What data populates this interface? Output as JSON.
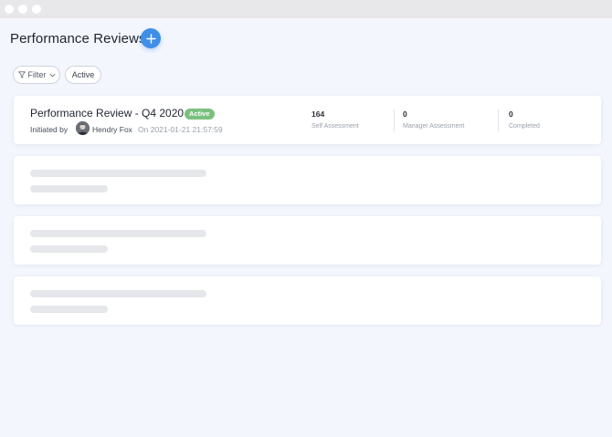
{
  "window": {
    "controls": [
      "close",
      "minimize",
      "maximize"
    ]
  },
  "header": {
    "title": "Performance Reviews",
    "add_icon": "plus-icon"
  },
  "toolbar": {
    "filter_label": "Filter",
    "filter_icon": "funnel-icon",
    "active_chip": "Active"
  },
  "review": {
    "title": "Performance Review - Q4 2020",
    "status": "Active",
    "initiated_label": "Initiated by",
    "user_name": "Hendry Fox",
    "timestamp": "On 2021-01-21 21:57:59",
    "stats": [
      {
        "value": "164",
        "label": "Self Assessment"
      },
      {
        "value": "0",
        "label": "Manager Assessment"
      },
      {
        "value": "0",
        "label": "Completed"
      }
    ]
  },
  "colors": {
    "accent": "#3f8ee8",
    "status_active": "#7ac07d",
    "background": "#f3f6fc",
    "skeleton": "#e5e7eb"
  },
  "skeleton_cards": 3
}
